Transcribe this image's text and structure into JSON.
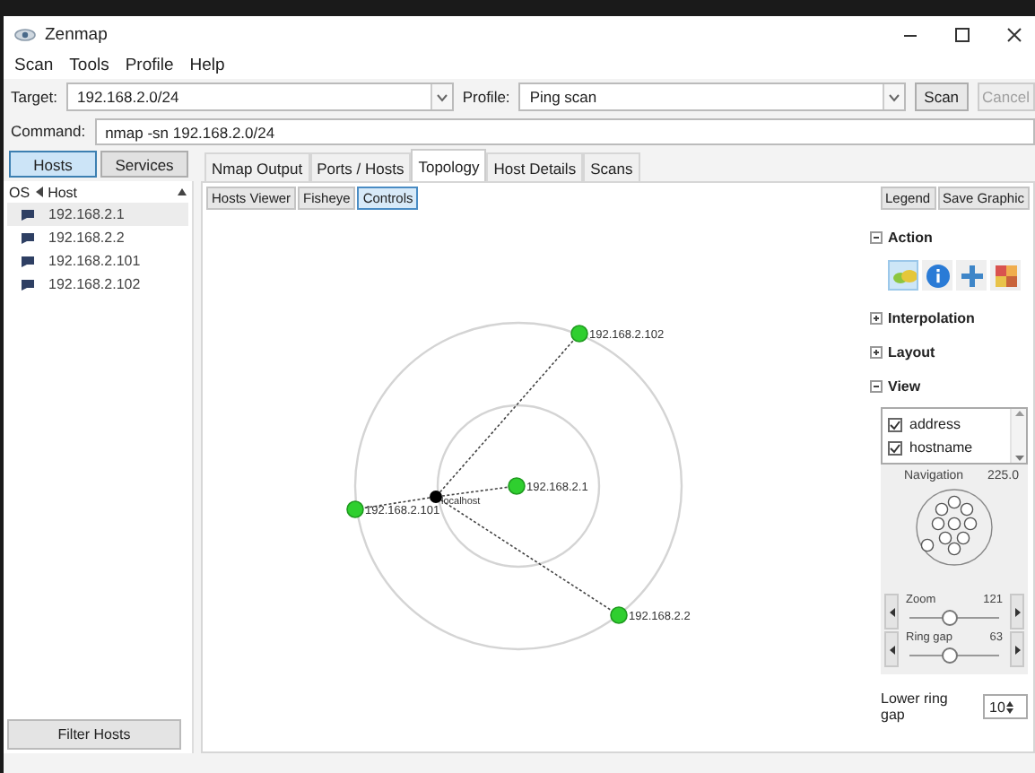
{
  "window": {
    "title": "Zenmap"
  },
  "menu": [
    {
      "label": "Scan"
    },
    {
      "label": "Tools"
    },
    {
      "label": "Profile"
    },
    {
      "label": "Help"
    }
  ],
  "target": {
    "label": "Target:",
    "value": "192.168.2.0/24"
  },
  "profile": {
    "label": "Profile:",
    "value": "Ping scan"
  },
  "buttons": [
    {
      "label": "Scan",
      "disabled": false
    },
    {
      "label": "Cancel",
      "disabled": true
    }
  ],
  "command": {
    "label": "Command:",
    "value": "nmap -sn 192.168.2.0/24"
  },
  "view_toggle": [
    {
      "label": "Hosts",
      "selected": true
    },
    {
      "label": "Services",
      "selected": false
    }
  ],
  "tabs": [
    {
      "label": "Nmap Output",
      "selected": false
    },
    {
      "label": "Ports / Hosts",
      "selected": false
    },
    {
      "label": "Topology",
      "selected": true
    },
    {
      "label": "Host Details",
      "selected": false
    },
    {
      "label": "Scans",
      "selected": false
    }
  ],
  "host_list": {
    "columns": [
      "OS",
      "Host"
    ],
    "rows": [
      {
        "host": "192.168.2.1",
        "selected": true
      },
      {
        "host": "192.168.2.2",
        "selected": false
      },
      {
        "host": "192.168.2.101",
        "selected": false
      },
      {
        "host": "192.168.2.102",
        "selected": false
      }
    ]
  },
  "filter_button": "Filter Hosts",
  "topology": {
    "views": [
      {
        "label": "Hosts Viewer",
        "selected": false
      },
      {
        "label": "Fisheye",
        "selected": false
      },
      {
        "label": "Controls",
        "selected": true
      }
    ],
    "buttons": [
      "Legend",
      "Save Graphic"
    ],
    "nodes": [
      {
        "label": "localhost",
        "kind": "local"
      },
      {
        "label": "192.168.2.1",
        "kind": "host"
      },
      {
        "label": "192.168.2.2",
        "kind": "host"
      },
      {
        "label": "192.168.2.101",
        "kind": "host"
      },
      {
        "label": "192.168.2.102",
        "kind": "host"
      }
    ]
  },
  "controls": {
    "sections": [
      {
        "title": "Action",
        "expanded": true,
        "kind": "action"
      },
      {
        "title": "Interpolation",
        "expanded": false
      },
      {
        "title": "Layout",
        "expanded": false
      },
      {
        "title": "View",
        "expanded": true,
        "kind": "view"
      }
    ],
    "actions": [
      {
        "kind": "hosts",
        "selected": true
      },
      {
        "kind": "info",
        "selected": false
      },
      {
        "kind": "add",
        "selected": false
      },
      {
        "kind": "palette",
        "selected": false
      }
    ],
    "view_options": [
      {
        "label": "address",
        "checked": true
      },
      {
        "label": "hostname",
        "checked": true
      }
    ],
    "navigation": {
      "label": "Navigation",
      "value": "225.0"
    },
    "sliders": [
      {
        "label": "Zoom",
        "value": "121",
        "level": 0.45
      },
      {
        "label": "Ring gap",
        "value": "63",
        "level": 0.45
      }
    ],
    "lower_ring_gap": {
      "label": "Lower ring gap",
      "value": "10"
    }
  }
}
